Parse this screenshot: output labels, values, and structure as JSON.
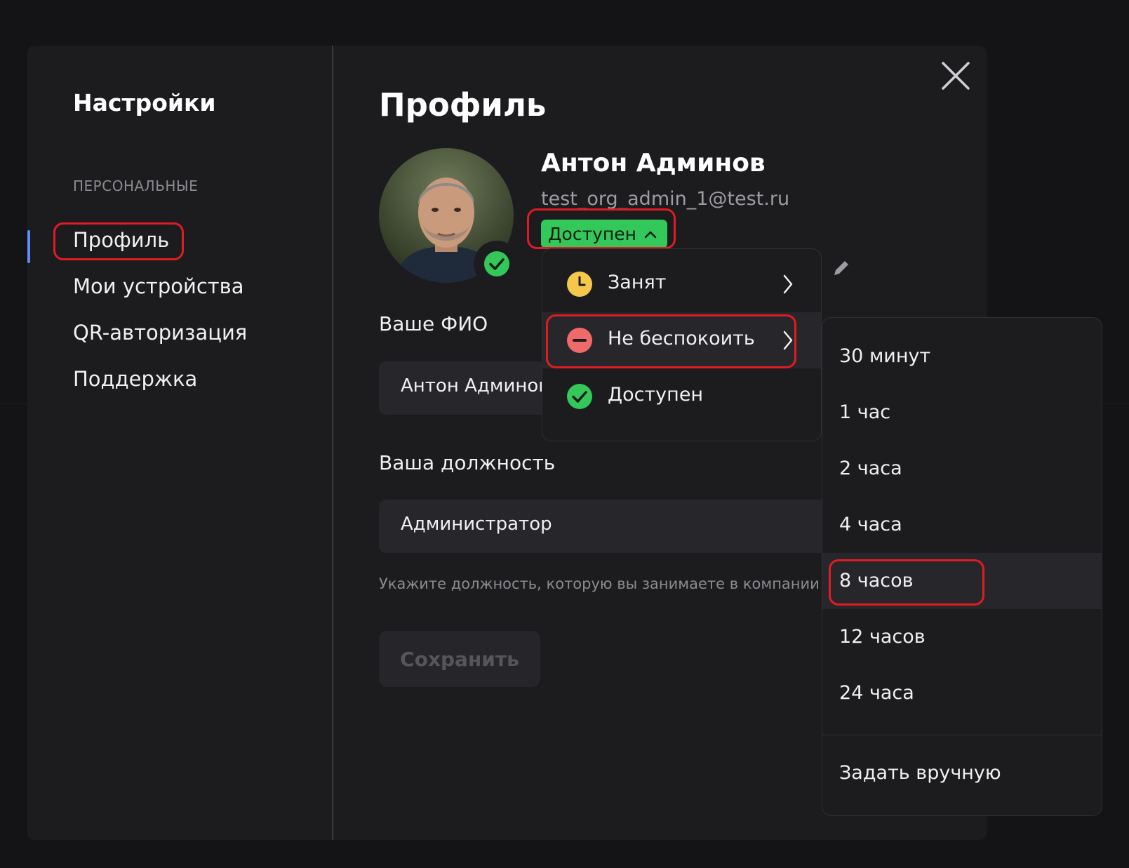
{
  "sidebar": {
    "title": "Настройки",
    "section_label": "ПЕРСОНАЛЬНЫЕ",
    "items": [
      {
        "label": "Профиль"
      },
      {
        "label": "Мои устройства"
      },
      {
        "label": "QR-авторизация"
      },
      {
        "label": "Поддержка"
      }
    ]
  },
  "profile": {
    "title": "Профиль",
    "name": "Антон Админов",
    "email": "test_org_admin_1@test.ru",
    "status_label": "Доступен",
    "fio_label": "Ваше ФИО",
    "fio_value": "Антон Админов",
    "position_label": "Ваша должность",
    "position_value": "Администратор",
    "position_hint": "Укажите должность, которую вы занимаете в компании",
    "save_label": "Сохранить"
  },
  "status_menu": {
    "items": [
      {
        "label": "Занят",
        "icon": "clock-icon",
        "color": "#f5c84c"
      },
      {
        "label": "Не беспокоить",
        "icon": "minus-circle-icon",
        "color": "#f06a6a"
      },
      {
        "label": "Доступен",
        "icon": "check-circle-icon",
        "color": "#34c759"
      }
    ]
  },
  "duration_menu": {
    "items": [
      "30 минут",
      "1 час",
      "2 часа",
      "4 часа",
      "8 часов",
      "12 часов",
      "24 часа"
    ],
    "custom_label": "Задать вручную"
  },
  "colors": {
    "accent": "#5b8df5",
    "available": "#34c759",
    "highlight": "#e11b22"
  }
}
